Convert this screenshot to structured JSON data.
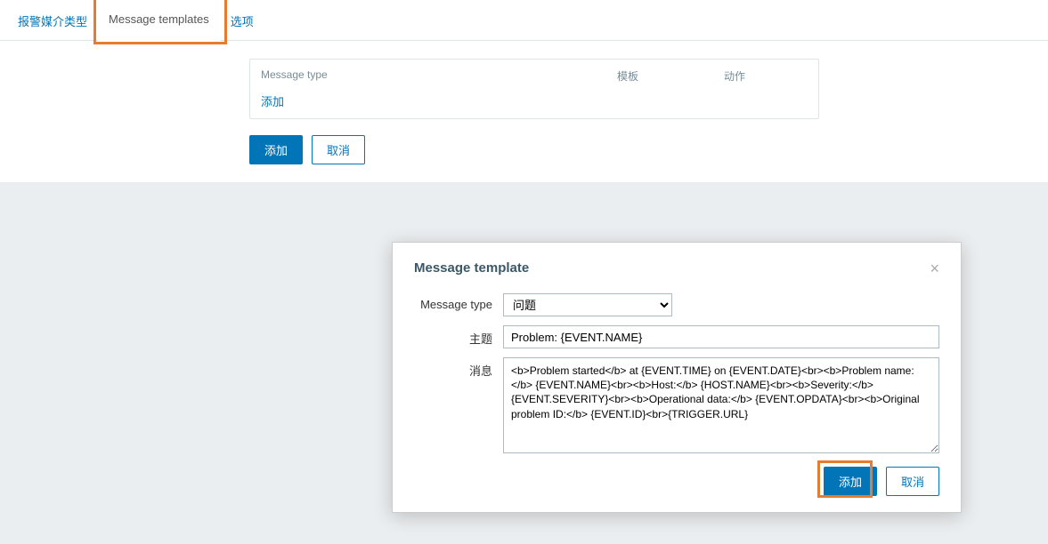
{
  "tabs": {
    "media_type": "报警媒介类型",
    "message_templates": "Message templates",
    "options": "选项"
  },
  "table": {
    "th_message_type": "Message type",
    "th_template": "模板",
    "th_action": "动作",
    "add_link": "添加"
  },
  "page_buttons": {
    "add": "添加",
    "cancel": "取消"
  },
  "modal": {
    "title": "Message template",
    "label_message_type": "Message type",
    "label_subject": "主题",
    "label_message": "消息",
    "select_value": "问题",
    "subject_value": "Problem: {EVENT.NAME}",
    "message_value": "<b>Problem started</b> at {EVENT.TIME} on {EVENT.DATE}<br><b>Problem name:</b> {EVENT.NAME}<br><b>Host:</b> {HOST.NAME}<br><b>Severity:</b> {EVENT.SEVERITY}<br><b>Operational data:</b> {EVENT.OPDATA}<br><b>Original problem ID:</b> {EVENT.ID}<br>{TRIGGER.URL}",
    "add": "添加",
    "cancel": "取消"
  }
}
